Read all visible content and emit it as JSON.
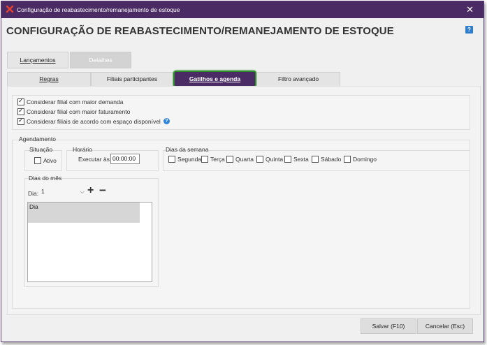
{
  "window": {
    "title": "Configuração de reabastecimento/remanejamento de estoque",
    "close_glyph": "✕"
  },
  "page": {
    "heading": "CONFIGURAÇÃO DE REABASTECIMENTO/REMANEJAMENTO DE ESTOQUE",
    "help_glyph": "?"
  },
  "main_tabs": [
    {
      "label": "Lançamentos",
      "active": true
    },
    {
      "label": "Detalhes",
      "active": false
    }
  ],
  "sub_tabs": [
    {
      "label": "Regras"
    },
    {
      "label": "Filiais participantes"
    },
    {
      "label": "Gatilhos e agenda",
      "active": true
    },
    {
      "label": "Filtro avançado"
    }
  ],
  "options": [
    {
      "label": "Considerar filial com maior demanda",
      "checked": true
    },
    {
      "label": "Considerar filial com maior faturamento",
      "checked": true
    },
    {
      "label": "Considerar filiais de acordo com espaço disponível",
      "checked": true
    }
  ],
  "agendamento": {
    "title": "Agendamento",
    "situacao": {
      "title": "Situação",
      "ativo_label": "Ativo",
      "ativo_checked": false
    },
    "horario": {
      "title": "Horário",
      "executar_label": "Executar às:",
      "time": "00:00:00"
    },
    "dias_semana": {
      "title": "Dias da semana",
      "days": [
        {
          "label": "Segunda",
          "checked": false
        },
        {
          "label": "Terça",
          "checked": false
        },
        {
          "label": "Quarta",
          "checked": false
        },
        {
          "label": "Quinta",
          "checked": false
        },
        {
          "label": "Sexta",
          "checked": false
        },
        {
          "label": "Sábado",
          "checked": false
        },
        {
          "label": "Domingo",
          "checked": false
        }
      ]
    },
    "dias_mes": {
      "title": "Dias do mês",
      "dia_label": "Dia:",
      "dia_value": "1",
      "add_glyph": "+",
      "remove_glyph": "−",
      "list_header": "Dia"
    }
  },
  "footer": {
    "save_label": "Salvar (F10)",
    "cancel_label": "Cancelar (Esc)"
  },
  "colors": {
    "title_bar": "#4a2b63",
    "active_tab": "#4a2b63",
    "active_tab_border": "#2a8c2a",
    "help_icon": "#2f7fd0"
  }
}
